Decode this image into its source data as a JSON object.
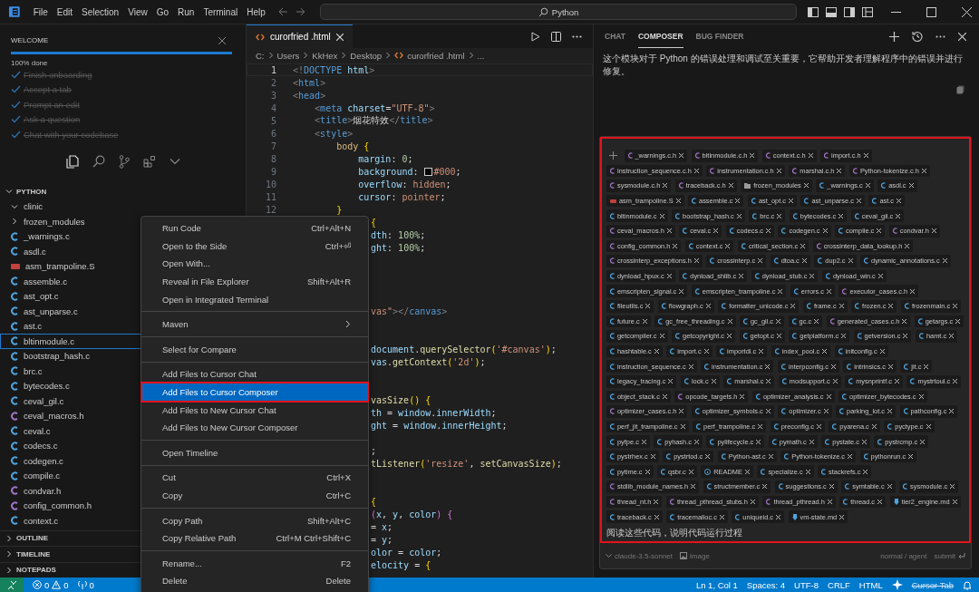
{
  "title_bar": {
    "menus": [
      "File",
      "Edit",
      "Selection",
      "View",
      "Go",
      "Run",
      "Terminal",
      "Help"
    ],
    "search": {
      "value": "Python"
    }
  },
  "welcome": {
    "title": "WELCOME",
    "progress": {
      "level": 1,
      "label": "100% done"
    },
    "steps": [
      {
        "label": "Finish onboarding",
        "done": true
      },
      {
        "label": "Accept a tab",
        "done": true
      },
      {
        "label": "Prompt an edit",
        "done": true
      },
      {
        "label": "Ask a question",
        "done": true
      },
      {
        "label": "Chat with your codebase",
        "done": true
      }
    ]
  },
  "view_icons": [
    {
      "kind": "explorer",
      "selected": true
    },
    {
      "kind": "search",
      "selected": false
    },
    {
      "kind": "source_control",
      "selected": false
    },
    {
      "kind": "extensions",
      "selected": false
    },
    {
      "kind": "more",
      "selected": false
    }
  ],
  "explorer": {
    "title": "PYTHON",
    "expanded": true,
    "items": [
      {
        "kind": "folder",
        "name": "clinic",
        "expanded": true,
        "selected": false
      },
      {
        "kind": "folder",
        "name": "frozen_modules",
        "expanded": false,
        "selected": false
      },
      {
        "kind": "c",
        "name": "_warnings.c",
        "selected": false
      },
      {
        "kind": "c",
        "name": "asdl.c",
        "selected": false
      },
      {
        "kind": "asm",
        "name": "asm_trampoline.S",
        "selected": false
      },
      {
        "kind": "c",
        "name": "assemble.c",
        "selected": false
      },
      {
        "kind": "c",
        "name": "ast_opt.c",
        "selected": false
      },
      {
        "kind": "c",
        "name": "ast_unparse.c",
        "selected": false
      },
      {
        "kind": "c",
        "name": "ast.c",
        "selected": false
      },
      {
        "kind": "c",
        "name": "bltinmodule.c",
        "selected": true
      },
      {
        "kind": "c",
        "name": "bootstrap_hash.c",
        "selected": false
      },
      {
        "kind": "c",
        "name": "brc.c",
        "selected": false
      },
      {
        "kind": "c",
        "name": "bytecodes.c",
        "selected": false
      },
      {
        "kind": "c",
        "name": "ceval_gil.c",
        "selected": false
      },
      {
        "kind": "h",
        "name": "ceval_macros.h",
        "selected": false
      },
      {
        "kind": "c",
        "name": "ceval.c",
        "selected": false
      },
      {
        "kind": "c",
        "name": "codecs.c",
        "selected": false
      },
      {
        "kind": "c",
        "name": "codegen.c",
        "selected": false
      },
      {
        "kind": "c",
        "name": "compile.c",
        "selected": false
      },
      {
        "kind": "h",
        "name": "condvar.h",
        "selected": false
      },
      {
        "kind": "h",
        "name": "config_common.h",
        "selected": false
      },
      {
        "kind": "c",
        "name": "context.c",
        "selected": false
      }
    ]
  },
  "sections": [
    {
      "title": "OUTLINE",
      "expanded": false
    },
    {
      "title": "TIMELINE",
      "expanded": false
    },
    {
      "title": "NOTEPADS",
      "expanded": false
    }
  ],
  "editor": {
    "tab": {
      "name": "curorfried .html"
    },
    "breadcrumbs": [
      "C:",
      "Users",
      "KkHex",
      "Desktop",
      "curorfried .html",
      "..."
    ],
    "lines": [
      {
        "number": "1",
        "current": true,
        "tokens": [
          {
            "kind": "p",
            "text": "<!"
          },
          {
            "kind": "k",
            "text": "DOCTYPE"
          },
          {
            "kind": "a",
            "text": " html"
          },
          {
            "kind": "p",
            "text": ">"
          }
        ]
      },
      {
        "number": "2",
        "current": false,
        "tokens": [
          {
            "kind": "p",
            "text": "<"
          },
          {
            "kind": "k",
            "text": "html"
          },
          {
            "kind": "p",
            "text": ">"
          }
        ]
      },
      {
        "number": "3",
        "current": false,
        "tokens": [
          {
            "kind": "p",
            "text": "<"
          },
          {
            "kind": "k",
            "text": "head"
          },
          {
            "kind": "p",
            "text": ">"
          }
        ]
      },
      {
        "number": "4",
        "current": false,
        "tokens": [
          {
            "kind": "p",
            "text": "    <"
          },
          {
            "kind": "k",
            "text": "meta"
          },
          {
            "kind": "a",
            "text": " charset"
          },
          {
            "kind": "x",
            "text": "="
          },
          {
            "kind": "s",
            "text": "\"UTF-8\""
          },
          {
            "kind": "p",
            "text": ">"
          }
        ]
      },
      {
        "number": "5",
        "current": false,
        "tokens": [
          {
            "kind": "p",
            "text": "    <"
          },
          {
            "kind": "k",
            "text": "title"
          },
          {
            "kind": "p",
            "text": ">"
          },
          {
            "kind": "x",
            "text": "烟花特效"
          },
          {
            "kind": "p",
            "text": "</"
          },
          {
            "kind": "k",
            "text": "title"
          },
          {
            "kind": "p",
            "text": ">"
          }
        ]
      },
      {
        "number": "6",
        "current": false,
        "tokens": [
          {
            "kind": "p",
            "text": "    <"
          },
          {
            "kind": "k",
            "text": "style"
          },
          {
            "kind": "p",
            "text": ">"
          }
        ]
      },
      {
        "number": "7",
        "current": false,
        "tokens": [
          {
            "kind": "sel",
            "text": "        body"
          },
          {
            "kind": "b",
            "text": " {"
          }
        ]
      },
      {
        "number": "8",
        "current": false,
        "tokens": [
          {
            "kind": "a",
            "text": "            margin"
          },
          {
            "kind": "x",
            "text": ": "
          },
          {
            "kind": "n",
            "text": "0"
          },
          {
            "kind": "x",
            "text": ";"
          }
        ]
      },
      {
        "number": "9",
        "current": false,
        "tokens": [
          {
            "kind": "a",
            "text": "            background"
          },
          {
            "kind": "x",
            "text": ": "
          },
          {
            "kind": "swatch"
          },
          {
            "kind": "s",
            "text": "#000"
          },
          {
            "kind": "x",
            "text": ";"
          }
        ]
      },
      {
        "number": "10",
        "current": false,
        "tokens": [
          {
            "kind": "a",
            "text": "            overflow"
          },
          {
            "kind": "x",
            "text": ": "
          },
          {
            "kind": "s",
            "text": "hidden"
          },
          {
            "kind": "x",
            "text": ";"
          }
        ]
      },
      {
        "number": "11",
        "current": false,
        "tokens": [
          {
            "kind": "a",
            "text": "            cursor"
          },
          {
            "kind": "x",
            "text": ": "
          },
          {
            "kind": "s",
            "text": "pointer"
          },
          {
            "kind": "x",
            "text": ";"
          }
        ]
      },
      {
        "number": "12",
        "current": false,
        "tokens": [
          {
            "kind": "b",
            "text": "        }"
          }
        ]
      }
    ],
    "fragments": [
      {
        "kind": "code",
        "tokens": [
          {
            "kind": "b",
            "text": "{"
          }
        ]
      },
      {
        "kind": "code",
        "tokens": [
          {
            "kind": "a",
            "text": "dth"
          },
          {
            "kind": "x",
            "text": ": "
          },
          {
            "kind": "n",
            "text": "100%"
          },
          {
            "kind": "x",
            "text": ";"
          }
        ]
      },
      {
        "kind": "code",
        "tokens": [
          {
            "kind": "a",
            "text": "ght"
          },
          {
            "kind": "x",
            "text": ": "
          },
          {
            "kind": "n",
            "text": "100%"
          },
          {
            "kind": "x",
            "text": ";"
          }
        ]
      },
      {
        "kind": "blank"
      },
      {
        "kind": "blank"
      },
      {
        "kind": "blank"
      },
      {
        "kind": "blank"
      },
      {
        "kind": "code",
        "tokens": [
          {
            "kind": "s",
            "text": "vas\""
          },
          {
            "kind": "p",
            "text": "></"
          },
          {
            "kind": "k",
            "text": "canvas"
          },
          {
            "kind": "p",
            "text": ">"
          }
        ]
      },
      {
        "kind": "blank"
      },
      {
        "kind": "blank"
      },
      {
        "kind": "code",
        "tokens": [
          {
            "kind": "v",
            "text": "document"
          },
          {
            "kind": "x",
            "text": "."
          },
          {
            "kind": "f",
            "text": "querySelector"
          },
          {
            "kind": "b",
            "text": "("
          },
          {
            "kind": "s",
            "text": "'#canvas'"
          },
          {
            "kind": "b",
            "text": ")"
          },
          {
            "kind": "x",
            "text": ";"
          }
        ]
      },
      {
        "kind": "code",
        "tokens": [
          {
            "kind": "v",
            "text": "vas"
          },
          {
            "kind": "x",
            "text": "."
          },
          {
            "kind": "f",
            "text": "getContext"
          },
          {
            "kind": "b",
            "text": "("
          },
          {
            "kind": "s",
            "text": "'2d'"
          },
          {
            "kind": "b",
            "text": ")"
          },
          {
            "kind": "x",
            "text": ";"
          }
        ]
      },
      {
        "kind": "blank"
      },
      {
        "kind": "blank"
      },
      {
        "kind": "code",
        "tokens": [
          {
            "kind": "f",
            "text": "vasSize"
          },
          {
            "kind": "b",
            "text": "() {"
          }
        ]
      },
      {
        "kind": "code",
        "tokens": [
          {
            "kind": "v",
            "text": "th"
          },
          {
            "kind": "x",
            "text": " = "
          },
          {
            "kind": "v",
            "text": "window"
          },
          {
            "kind": "x",
            "text": "."
          },
          {
            "kind": "v",
            "text": "innerWidth"
          },
          {
            "kind": "x",
            "text": ";"
          }
        ]
      },
      {
        "kind": "code",
        "tokens": [
          {
            "kind": "v",
            "text": "ght"
          },
          {
            "kind": "x",
            "text": " = "
          },
          {
            "kind": "v",
            "text": "window"
          },
          {
            "kind": "x",
            "text": "."
          },
          {
            "kind": "v",
            "text": "innerHeight"
          },
          {
            "kind": "x",
            "text": ";"
          }
        ]
      },
      {
        "kind": "blank"
      },
      {
        "kind": "code",
        "tokens": [
          {
            "kind": "x",
            "text": ";"
          }
        ]
      },
      {
        "kind": "code",
        "tokens": [
          {
            "kind": "f",
            "text": "tListener"
          },
          {
            "kind": "b",
            "text": "("
          },
          {
            "kind": "s",
            "text": "'resize'"
          },
          {
            "kind": "x",
            "text": ", "
          },
          {
            "kind": "f",
            "text": "setCanvasSize"
          },
          {
            "kind": "b",
            "text": ")"
          },
          {
            "kind": "x",
            "text": ";"
          }
        ]
      },
      {
        "kind": "blank"
      },
      {
        "kind": "blank"
      },
      {
        "kind": "code",
        "tokens": [
          {
            "kind": "b",
            "text": "{"
          }
        ]
      },
      {
        "kind": "code",
        "tokens": [
          {
            "kind": "m",
            "text": "("
          },
          {
            "kind": "v",
            "text": "x"
          },
          {
            "kind": "x",
            "text": ", "
          },
          {
            "kind": "v",
            "text": "y"
          },
          {
            "kind": "x",
            "text": ", "
          },
          {
            "kind": "v",
            "text": "color"
          },
          {
            "kind": "m",
            "text": ") {"
          }
        ]
      },
      {
        "kind": "code",
        "tokens": [
          {
            "kind": "x",
            "text": "= "
          },
          {
            "kind": "v",
            "text": "x"
          },
          {
            "kind": "x",
            "text": ";"
          }
        ]
      },
      {
        "kind": "code",
        "tokens": [
          {
            "kind": "x",
            "text": "= "
          },
          {
            "kind": "v",
            "text": "y"
          },
          {
            "kind": "x",
            "text": ";"
          }
        ]
      },
      {
        "kind": "code",
        "tokens": [
          {
            "kind": "v",
            "text": "olor"
          },
          {
            "kind": "x",
            "text": " = "
          },
          {
            "kind": "v",
            "text": "color"
          },
          {
            "kind": "x",
            "text": ";"
          }
        ]
      },
      {
        "kind": "code",
        "tokens": [
          {
            "kind": "v",
            "text": "elocity"
          },
          {
            "kind": "x",
            "text": " = "
          },
          {
            "kind": "b",
            "text": "{"
          }
        ]
      }
    ]
  },
  "context_menu": {
    "groups": [
      {
        "items": [
          {
            "label": "Run Code",
            "shortcut": "Ctrl+Alt+N",
            "selected": false,
            "submenu": false
          },
          {
            "label": "Open to the Side",
            "shortcut": "Ctrl+⏎",
            "selected": false,
            "submenu": false
          },
          {
            "label": "Open With...",
            "selected": false,
            "submenu": false
          },
          {
            "label": "Reveal in File Explorer",
            "shortcut": "Shift+Alt+R",
            "selected": false,
            "submenu": false
          },
          {
            "label": "Open in Integrated Terminal",
            "selected": false,
            "submenu": false
          }
        ]
      },
      {
        "items": [
          {
            "label": "Maven",
            "selected": false,
            "submenu": true
          }
        ]
      },
      {
        "items": [
          {
            "label": "Select for Compare",
            "selected": false,
            "submenu": false
          }
        ]
      },
      {
        "items": [
          {
            "label": "Add Files to Cursor Chat",
            "selected": false,
            "submenu": false
          },
          {
            "label": "Add Files to Cursor Composer",
            "selected": true,
            "submenu": false
          },
          {
            "label": "Add Files to New Cursor Chat",
            "selected": false,
            "submenu": false
          },
          {
            "label": "Add Files to New Cursor Composer",
            "selected": false,
            "submenu": false
          }
        ]
      },
      {
        "items": [
          {
            "label": "Open Timeline",
            "selected": false,
            "submenu": false
          }
        ]
      },
      {
        "items": [
          {
            "label": "Cut",
            "shortcut": "Ctrl+X",
            "selected": false,
            "submenu": false
          },
          {
            "label": "Copy",
            "shortcut": "Ctrl+C",
            "selected": false,
            "submenu": false
          }
        ]
      },
      {
        "items": [
          {
            "label": "Copy Path",
            "shortcut": "Shift+Alt+C",
            "selected": false,
            "submenu": false
          },
          {
            "label": "Copy Relative Path",
            "shortcut": "Ctrl+M Ctrl+Shift+C",
            "selected": false,
            "submenu": false
          }
        ]
      },
      {
        "items": [
          {
            "label": "Rename...",
            "shortcut": "F2",
            "selected": false,
            "submenu": false
          },
          {
            "label": "Delete",
            "shortcut": "Delete",
            "selected": false,
            "submenu": false
          }
        ]
      }
    ]
  },
  "composer": {
    "tabs": [
      {
        "label": "CHAT",
        "selected": false
      },
      {
        "label": "COMPOSER",
        "selected": true
      },
      {
        "label": "BUG FINDER",
        "selected": false
      }
    ],
    "message": "这个模块对于 Python 的错误处理和调试至关重要，它帮助开发者理解程序中的错误并进行修复。",
    "input": {
      "annotated": true,
      "value": "阅读这些代码，说明代码运行过程",
      "files": [
        {
          "kind": "h",
          "name": "_warnings.c.h"
        },
        {
          "kind": "h",
          "name": "bltinmodule.c.h"
        },
        {
          "kind": "h",
          "name": "context.c.h"
        },
        {
          "kind": "h",
          "name": "import.c.h"
        },
        {
          "kind": "h",
          "name": "instruction_sequence.c.h"
        },
        {
          "kind": "h",
          "name": "instrumentation.c.h"
        },
        {
          "kind": "h",
          "name": "marshal.c.h"
        },
        {
          "kind": "h",
          "name": "Python-tokenize.c.h"
        },
        {
          "kind": "h",
          "name": "sysmodule.c.h"
        },
        {
          "kind": "h",
          "name": "traceback.c.h"
        },
        {
          "kind": "folder",
          "name": "frozen_modules"
        },
        {
          "kind": "c",
          "name": "_warnings.c"
        },
        {
          "kind": "c",
          "name": "asdl.c"
        },
        {
          "kind": "asm",
          "name": "asm_trampoline.S"
        },
        {
          "kind": "c",
          "name": "assemble.c"
        },
        {
          "kind": "c",
          "name": "ast_opt.c"
        },
        {
          "kind": "c",
          "name": "ast_unparse.c"
        },
        {
          "kind": "c",
          "name": "ast.c"
        },
        {
          "kind": "c",
          "name": "bltinmodule.c"
        },
        {
          "kind": "c",
          "name": "bootstrap_hash.c"
        },
        {
          "kind": "c",
          "name": "brc.c"
        },
        {
          "kind": "c",
          "name": "bytecodes.c"
        },
        {
          "kind": "c",
          "name": "ceval_gil.c"
        },
        {
          "kind": "h",
          "name": "ceval_macros.h"
        },
        {
          "kind": "c",
          "name": "ceval.c"
        },
        {
          "kind": "c",
          "name": "codecs.c"
        },
        {
          "kind": "c",
          "name": "codegen.c"
        },
        {
          "kind": "c",
          "name": "compile.c"
        },
        {
          "kind": "h",
          "name": "condvar.h"
        },
        {
          "kind": "h",
          "name": "config_common.h"
        },
        {
          "kind": "c",
          "name": "context.c"
        },
        {
          "kind": "c",
          "name": "critical_section.c"
        },
        {
          "kind": "h",
          "name": "crossinterp_data_lookup.h"
        },
        {
          "kind": "h",
          "name": "crossinterp_exceptions.h"
        },
        {
          "kind": "c",
          "name": "crossinterp.c"
        },
        {
          "kind": "c",
          "name": "dtoa.c"
        },
        {
          "kind": "c",
          "name": "dup2.c"
        },
        {
          "kind": "c",
          "name": "dynamic_annotations.c"
        },
        {
          "kind": "c",
          "name": "dynload_hpux.c"
        },
        {
          "kind": "c",
          "name": "dynload_shlib.c"
        },
        {
          "kind": "c",
          "name": "dynload_stub.c"
        },
        {
          "kind": "c",
          "name": "dynload_win.c"
        },
        {
          "kind": "c",
          "name": "emscripten_signal.c"
        },
        {
          "kind": "c",
          "name": "emscripten_trampoline.c"
        },
        {
          "kind": "c",
          "name": "errors.c"
        },
        {
          "kind": "h",
          "name": "executor_cases.c.h"
        },
        {
          "kind": "c",
          "name": "fileutils.c"
        },
        {
          "kind": "c",
          "name": "flowgraph.c"
        },
        {
          "kind": "c",
          "name": "formatter_unicode.c"
        },
        {
          "kind": "c",
          "name": "frame.c"
        },
        {
          "kind": "c",
          "name": "frozen.c"
        },
        {
          "kind": "c",
          "name": "frozenmain.c"
        },
        {
          "kind": "c",
          "name": "future.c"
        },
        {
          "kind": "c",
          "name": "gc_free_threading.c"
        },
        {
          "kind": "c",
          "name": "gc_gil.c"
        },
        {
          "kind": "c",
          "name": "gc.c"
        },
        {
          "kind": "h",
          "name": "generated_cases.c.h"
        },
        {
          "kind": "c",
          "name": "getargs.c"
        },
        {
          "kind": "c",
          "name": "getcompiler.c"
        },
        {
          "kind": "c",
          "name": "getcopyright.c"
        },
        {
          "kind": "c",
          "name": "getopt.c"
        },
        {
          "kind": "c",
          "name": "getplatform.c"
        },
        {
          "kind": "c",
          "name": "getversion.c"
        },
        {
          "kind": "c",
          "name": "hamt.c"
        },
        {
          "kind": "c",
          "name": "hashtable.c"
        },
        {
          "kind": "c",
          "name": "import.c"
        },
        {
          "kind": "c",
          "name": "importdl.c"
        },
        {
          "kind": "c",
          "name": "index_pool.c"
        },
        {
          "kind": "c",
          "name": "initconfig.c"
        },
        {
          "kind": "c",
          "name": "instruction_sequence.c"
        },
        {
          "kind": "c",
          "name": "instrumentation.c"
        },
        {
          "kind": "c",
          "name": "interpconfig.c"
        },
        {
          "kind": "c",
          "name": "intrinsics.c"
        },
        {
          "kind": "c",
          "name": "jit.c"
        },
        {
          "kind": "c",
          "name": "legacy_tracing.c"
        },
        {
          "kind": "c",
          "name": "lock.c"
        },
        {
          "kind": "c",
          "name": "marshal.c"
        },
        {
          "kind": "c",
          "name": "modsupport.c"
        },
        {
          "kind": "c",
          "name": "mysnprintf.c"
        },
        {
          "kind": "c",
          "name": "mystrtoul.c"
        },
        {
          "kind": "c",
          "name": "object_stack.c"
        },
        {
          "kind": "h",
          "name": "opcode_targets.h"
        },
        {
          "kind": "c",
          "name": "optimizer_analysis.c"
        },
        {
          "kind": "c",
          "name": "optimizer_bytecodes.c"
        },
        {
          "kind": "h",
          "name": "optimizer_cases.c.h"
        },
        {
          "kind": "c",
          "name": "optimizer_symbols.c"
        },
        {
          "kind": "c",
          "name": "optimizer.c"
        },
        {
          "kind": "c",
          "name": "parking_lot.c"
        },
        {
          "kind": "c",
          "name": "pathconfig.c"
        },
        {
          "kind": "c",
          "name": "perf_jit_trampoline.c"
        },
        {
          "kind": "c",
          "name": "perf_trampoline.c"
        },
        {
          "kind": "c",
          "name": "preconfig.c"
        },
        {
          "kind": "c",
          "name": "pyarena.c"
        },
        {
          "kind": "c",
          "name": "pyctype.c"
        },
        {
          "kind": "c",
          "name": "pyfpe.c"
        },
        {
          "kind": "c",
          "name": "pyhash.c"
        },
        {
          "kind": "c",
          "name": "pylifecycle.c"
        },
        {
          "kind": "c",
          "name": "pymath.c"
        },
        {
          "kind": "c",
          "name": "pystate.c"
        },
        {
          "kind": "c",
          "name": "pystrcmp.c"
        },
        {
          "kind": "c",
          "name": "pystrhex.c"
        },
        {
          "kind": "c",
          "name": "pystrtod.c"
        },
        {
          "kind": "c",
          "name": "Python-ast.c"
        },
        {
          "kind": "c",
          "name": "Python-tokenize.c"
        },
        {
          "kind": "c",
          "name": "pythonrun.c"
        },
        {
          "kind": "c",
          "name": "pytime.c"
        },
        {
          "kind": "c",
          "name": "qsbr.c"
        },
        {
          "kind": "info",
          "name": "README"
        },
        {
          "kind": "c",
          "name": "specialize.c"
        },
        {
          "kind": "c",
          "name": "stackrefs.c"
        },
        {
          "kind": "h",
          "name": "stdlib_module_names.h"
        },
        {
          "kind": "c",
          "name": "structmember.c"
        },
        {
          "kind": "c",
          "name": "suggestions.c"
        },
        {
          "kind": "c",
          "name": "symtable.c"
        },
        {
          "kind": "c",
          "name": "sysmodule.c"
        },
        {
          "kind": "h",
          "name": "thread_nt.h"
        },
        {
          "kind": "h",
          "name": "thread_pthread_stubs.h"
        },
        {
          "kind": "h",
          "name": "thread_pthread.h"
        },
        {
          "kind": "c",
          "name": "thread.c"
        },
        {
          "kind": "md",
          "name": "tier2_engine.md"
        },
        {
          "kind": "c",
          "name": "traceback.c"
        },
        {
          "kind": "c",
          "name": "tracemalloc.c"
        },
        {
          "kind": "c",
          "name": "uniqueid.c"
        },
        {
          "kind": "md",
          "name": "vm-state.md"
        }
      ]
    },
    "model": "claude-3.5-sonnet",
    "image_label": "image",
    "mode": "normal / agent",
    "submit": "submit"
  },
  "status_bar": {
    "errors": "0",
    "warnings": "0",
    "ports": "0",
    "items": [
      "Ln 1, Col 1",
      "Spaces: 4",
      "UTF-8",
      "CRLF",
      "HTML"
    ],
    "cursor_tab": {
      "label": "Cursor Tab",
      "disabled": true
    }
  }
}
